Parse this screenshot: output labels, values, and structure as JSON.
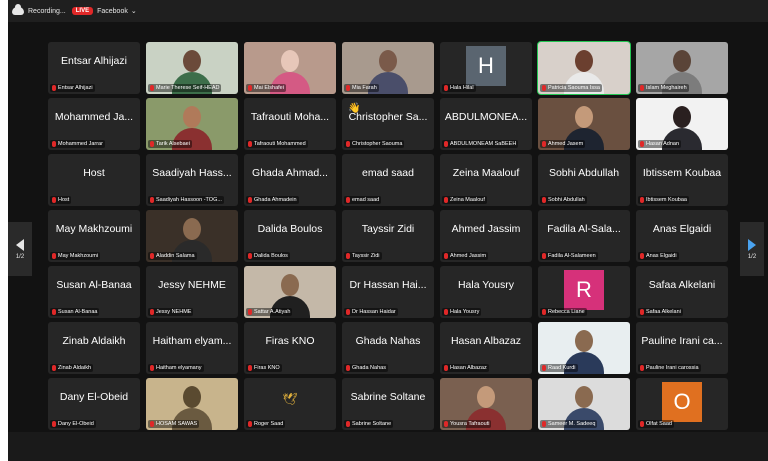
{
  "topbar": {
    "recording_label": "Recording...",
    "live_label": "LIVE",
    "stream_label": "Facebook",
    "stream_chevron": "⌄"
  },
  "pagination": {
    "left": "1/2",
    "right": "1/2"
  },
  "colors": {
    "active_speaker": "#23c552",
    "muted_mic": "#e02828",
    "live": "#e02828",
    "next_arrow": "#4aa3f0"
  },
  "tiles": [
    {
      "name": "Entsar Alhijazi",
      "label": "Entsar Alhijazi",
      "video": false
    },
    {
      "name": "",
      "label": "Marie Therese Seif-HEAD",
      "video": true,
      "bg": "#c9d2c4",
      "head": "#6b4a3a",
      "body": "#3c6e4a"
    },
    {
      "name": "",
      "label": "Mai Elshafei",
      "video": true,
      "bg": "#b89a8c",
      "head": "#e7c7b9",
      "body": "#d45a84"
    },
    {
      "name": "",
      "label": "Mia Farah",
      "video": true,
      "bg": "#a89a8e",
      "head": "#7a5a4a",
      "body": "#4a4e6a"
    },
    {
      "name": "",
      "label": "Hala Hilal",
      "video": false,
      "letter": "H",
      "letter_bg": "#5a6570"
    },
    {
      "name": "",
      "label": "Patricia Saouma Issa",
      "video": true,
      "bg": "#d8d0ca",
      "head": "#6b3f2f",
      "body": "#e9e9e9",
      "active": true
    },
    {
      "name": "",
      "label": "Islam Meghaireh",
      "video": true,
      "bg": "#a6a6a6",
      "head": "#5a4438",
      "body": "#7c7c7c"
    },
    {
      "name": "Mohammed Ja...",
      "label": "Mohammed Jarrar",
      "video": false
    },
    {
      "name": "",
      "label": "Tarik Alsebaei",
      "video": true,
      "bg": "#8a9a6a",
      "head": "#b07a5a",
      "body": "#8a3030"
    },
    {
      "name": "Tafraouti Moha...",
      "label": "Tafraouti Mohammed",
      "video": false
    },
    {
      "name": "Christopher Sa...",
      "label": "Christopher Saouma",
      "video": false,
      "wave": "👋"
    },
    {
      "name": "ABDULMONEA...",
      "label": "ABDULMONEAM SaBEEH",
      "video": false
    },
    {
      "name": "",
      "label": "Ahmed Jasem",
      "video": true,
      "bg": "#6a5040",
      "head": "#c49a7a",
      "body": "#1e2430"
    },
    {
      "name": "",
      "label": "Hasan Adnan",
      "video": true,
      "bg": "#f2f2f2",
      "head": "#2a2020",
      "body": "#2a2a30"
    },
    {
      "name": "Host",
      "label": "Host",
      "video": false
    },
    {
      "name": "Saadiyah Hass...",
      "label": "Saadiyah Hassoon -TOG...",
      "video": false
    },
    {
      "name": "Ghada Ahmad...",
      "label": "Ghada Ahmadein",
      "video": false
    },
    {
      "name": "emad saad",
      "label": "emad saad",
      "video": false
    },
    {
      "name": "Zeina Maalouf",
      "label": "Zeina Maalouf",
      "video": false
    },
    {
      "name": "Sobhi Abdullah",
      "label": "Sobhi Abdullah",
      "video": false
    },
    {
      "name": "Ibtissem Koubaa",
      "label": "Ibtissem Koubaa",
      "video": false
    },
    {
      "name": "May Makhzoumi",
      "label": "May Makhzoumi",
      "video": false
    },
    {
      "name": "",
      "label": "Aladdin Salama",
      "video": true,
      "bg": "#3a3028",
      "head": "#8a6a50",
      "body": "#2a2a2a"
    },
    {
      "name": "Dalida Boulos",
      "label": "Dalida Boulos",
      "video": false
    },
    {
      "name": "Tayssir Zidi",
      "label": "Tayssir Zidi",
      "video": false
    },
    {
      "name": "Ahmed Jassim",
      "label": "Ahmed Jassim",
      "video": false
    },
    {
      "name": "Fadila Al-Sala...",
      "label": "Fadila Al-Salameen",
      "video": false
    },
    {
      "name": "Anas Elgaidi",
      "label": "Anas Elgaidi",
      "video": false
    },
    {
      "name": "Susan Al-Banaa",
      "label": "Susan Al-Banaa",
      "video": false
    },
    {
      "name": "Jessy NEHME",
      "label": "Jessy NEHME",
      "video": false
    },
    {
      "name": "",
      "label": "Sattar A.Atiyah",
      "video": true,
      "bg": "#c4b8a8",
      "head": "#8a6a50",
      "body": "#202020"
    },
    {
      "name": "Dr Hassan Hai...",
      "label": "Dr Hassan Haidar",
      "video": false
    },
    {
      "name": "Hala Yousry",
      "label": "Hala Yousry",
      "video": false
    },
    {
      "name": "",
      "label": "Rebecca Liane",
      "video": false,
      "letter": "R",
      "letter_bg": "#d6317a"
    },
    {
      "name": "Safaa Alkelani",
      "label": "Safaa Alkelani",
      "video": false
    },
    {
      "name": "Zinab Aldaikh",
      "label": "Zinab Aldaikh",
      "video": false
    },
    {
      "name": "Haitham elyam...",
      "label": "Haitham elyamany",
      "video": false
    },
    {
      "name": "Firas KNO",
      "label": "Firas KNO",
      "video": false
    },
    {
      "name": "Ghada Nahas",
      "label": "Ghada Nahas",
      "video": false
    },
    {
      "name": "Hasan Albazaz",
      "label": "Hasan Albazaz",
      "video": false
    },
    {
      "name": "",
      "label": "Raad Kurdi",
      "video": true,
      "bg": "#e8eef0",
      "head": "#8a6a50",
      "body": "#2a3a5a"
    },
    {
      "name": "Pauline Irani ca...",
      "label": "Pauline Irani carossia",
      "video": false
    },
    {
      "name": "Dany El-Obeid",
      "label": "Dany El-Obeid",
      "video": false
    },
    {
      "name": "",
      "label": "HOSAM SAWAS",
      "video": true,
      "bg": "#c8b48c",
      "head": "#5a4a30",
      "body": "#6a5a40"
    },
    {
      "name": "",
      "label": "Roger Saad",
      "video": false,
      "logo": "🕊"
    },
    {
      "name": "Sabrine Soltane",
      "label": "Sabrine Soltane",
      "video": false
    },
    {
      "name": "",
      "label": "Yousra Tafraouti",
      "video": true,
      "bg": "#7a6050",
      "head": "#c49a7a",
      "body": "#8a3030"
    },
    {
      "name": "",
      "label": "Sameer M. Sadeeq",
      "video": true,
      "bg": "#dcdcdc",
      "head": "#8a6a50",
      "body": "#3a4a6a"
    },
    {
      "name": "",
      "label": "Olfat Saad",
      "video": false,
      "letter": "O",
      "letter_bg": "#e07020"
    }
  ]
}
